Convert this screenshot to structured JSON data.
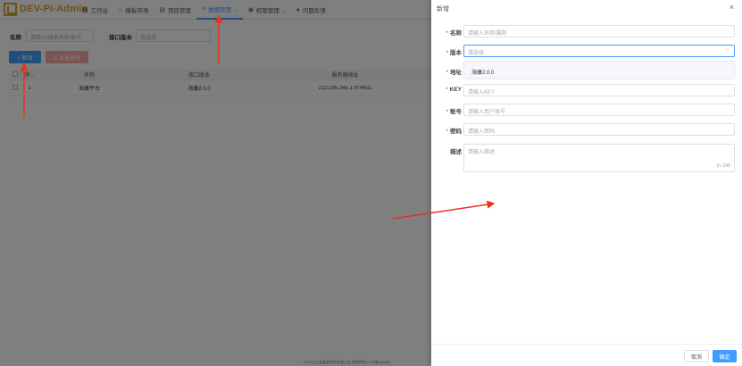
{
  "app": {
    "brand": "DEV-Pi-Admin",
    "nav": [
      {
        "icon": "▦",
        "label": "工作台"
      },
      {
        "icon": "⌂",
        "label": "模板市场"
      },
      {
        "icon": "▤",
        "label": "项目管理"
      },
      {
        "icon": "≡",
        "label": "数据管理 ⌵"
      },
      {
        "icon": "◉",
        "label": "权限管理 ⌵"
      },
      {
        "icon": "●",
        "label": "问题反馈"
      }
    ]
  },
  "filter": {
    "name_label": "名称",
    "name_placeholder": "请输入/搜索名称/账号",
    "version_label": "接口版本",
    "version_placeholder": "请选择"
  },
  "toolbar": {
    "add_label": "+ 新增",
    "batch_delete_label": "⊖ 批量删除"
  },
  "table": {
    "headers": [
      "",
      "序...",
      "名称",
      "接口版本",
      "服务器地址"
    ],
    "rows": [
      {
        "index": "1",
        "name": "海康平台",
        "version": "海康2.0.0",
        "address": "222.185.245.179:4431"
      }
    ]
  },
  "footer_text": "©2024 上海某某科技有限公司 版权所有 | ICP备100000",
  "drawer": {
    "title": "新增",
    "close_icon": "×",
    "fields": {
      "name": {
        "label": "名称",
        "placeholder": "请输入名称/属称"
      },
      "version": {
        "label": "版本",
        "placeholder": "请选择"
      },
      "address": {
        "label": "地址"
      },
      "key": {
        "label": "KEY",
        "placeholder": "请输入KEY"
      },
      "account": {
        "label": "账号",
        "placeholder": "请输入用户账号"
      },
      "password": {
        "label": "密码",
        "placeholder": "请输入密码"
      },
      "description": {
        "label": "描述",
        "placeholder": "请输入描述",
        "counter": "0 / 240"
      }
    },
    "dropdown_option": "海康2.0.0",
    "cancel_label": "取消",
    "ok_label": "确定"
  },
  "colors": {
    "primary": "#409eff",
    "brand": "#e0a030",
    "danger": "#f56c6c",
    "annotation_arrow": "#e8341c"
  }
}
